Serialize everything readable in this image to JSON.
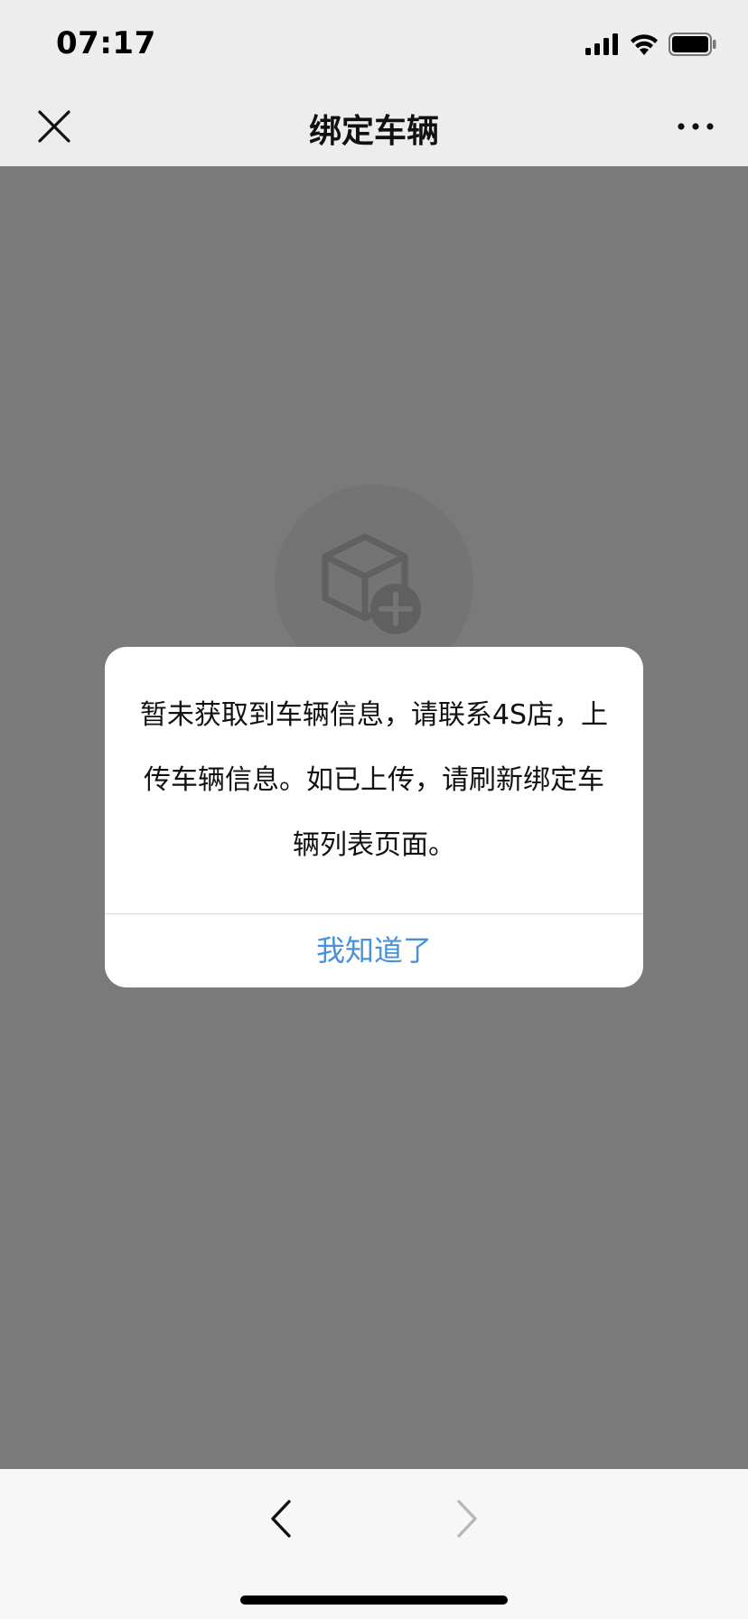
{
  "status_bar": {
    "time": "07:17"
  },
  "nav": {
    "title": "绑定车辆",
    "close_icon": "close-icon",
    "more_icon": "more-icon"
  },
  "content": {
    "empty_icon": "box-plus-icon"
  },
  "dialog": {
    "message": "暂未获取到车辆信息，请联系4S店，上传车辆信息。如已上传，请刷新绑定车辆列表页面。",
    "button_label": "我知道了"
  },
  "toolbar": {
    "back_icon": "chevron-left-icon",
    "forward_icon": "chevron-right-icon"
  },
  "colors": {
    "accent": "#4a90d9",
    "mask": "rgba(0,0,0,0.52)"
  }
}
